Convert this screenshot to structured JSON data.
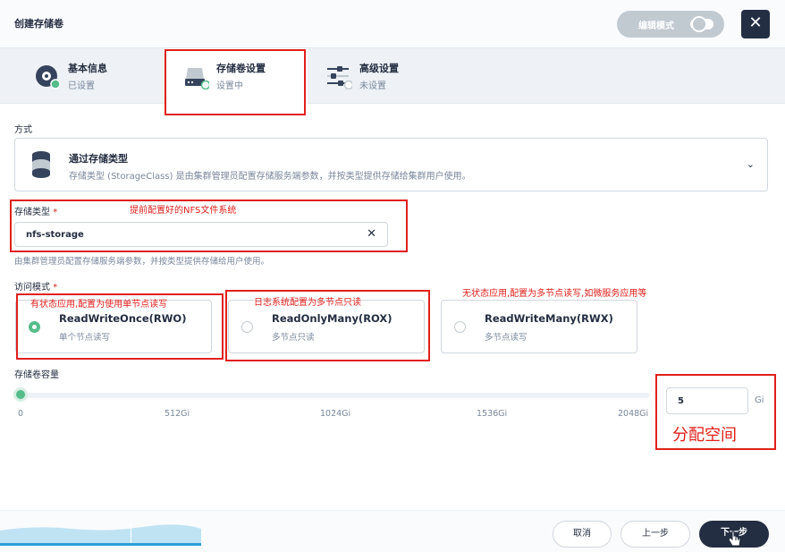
{
  "header": {
    "title": "创建存储卷",
    "edit_mode_label": "编辑模式",
    "close_glyph": "✕"
  },
  "steps": [
    {
      "title": "基本信息",
      "status": "已设置",
      "icon": "disk-icon"
    },
    {
      "title": "存储卷设置",
      "status": "设置中",
      "icon": "storage-icon"
    },
    {
      "title": "高级设置",
      "status": "未设置",
      "icon": "sliders-icon"
    }
  ],
  "method": {
    "label": "方式",
    "title": "通过存储类型",
    "description": "存储类型 (StorageClass) 是由集群管理员配置存储服务端参数，并按类型提供存储给集群用户使用。",
    "chevron": "⌄"
  },
  "storage_class": {
    "label": "存储类型",
    "required_mark": "*",
    "value": "nfs-storage",
    "clear_glyph": "✕",
    "hint": "由集群管理员配置存储服务端参数，并按类型提供存储给用户使用。"
  },
  "access_mode": {
    "label": "访问模式",
    "required_mark": "*",
    "options": [
      {
        "title": "ReadWriteOnce(RWO)",
        "subtitle": "单个节点读写",
        "selected": true
      },
      {
        "title": "ReadOnlyMany(ROX)",
        "subtitle": "多节点只读",
        "selected": false
      },
      {
        "title": "ReadWriteMany(RWX)",
        "subtitle": "多节点读写",
        "selected": false
      }
    ]
  },
  "capacity": {
    "label": "存储卷容量",
    "ticks": [
      "0",
      "512Gi",
      "1024Gi",
      "1536Gi",
      "2048Gi"
    ],
    "value": "5",
    "unit": "Gi",
    "slider_fraction": 0.0024
  },
  "annotations": {
    "storage_class_note": "提前配置好的NFS文件系统",
    "rwo_note": "有状态应用,配置为使用单节点读写",
    "rox_note": "日志系统配置为多节点只读",
    "rwx_note": "无状态应用,配置为多节点读写,如微服务应用等",
    "capacity_note": "分配空间"
  },
  "footer": {
    "cancel": "取消",
    "prev": "上一步",
    "next": "下一步"
  },
  "colors": {
    "accent_green": "#55bc8a",
    "dark": "#242e42",
    "annotation_red": "#e0201b"
  }
}
